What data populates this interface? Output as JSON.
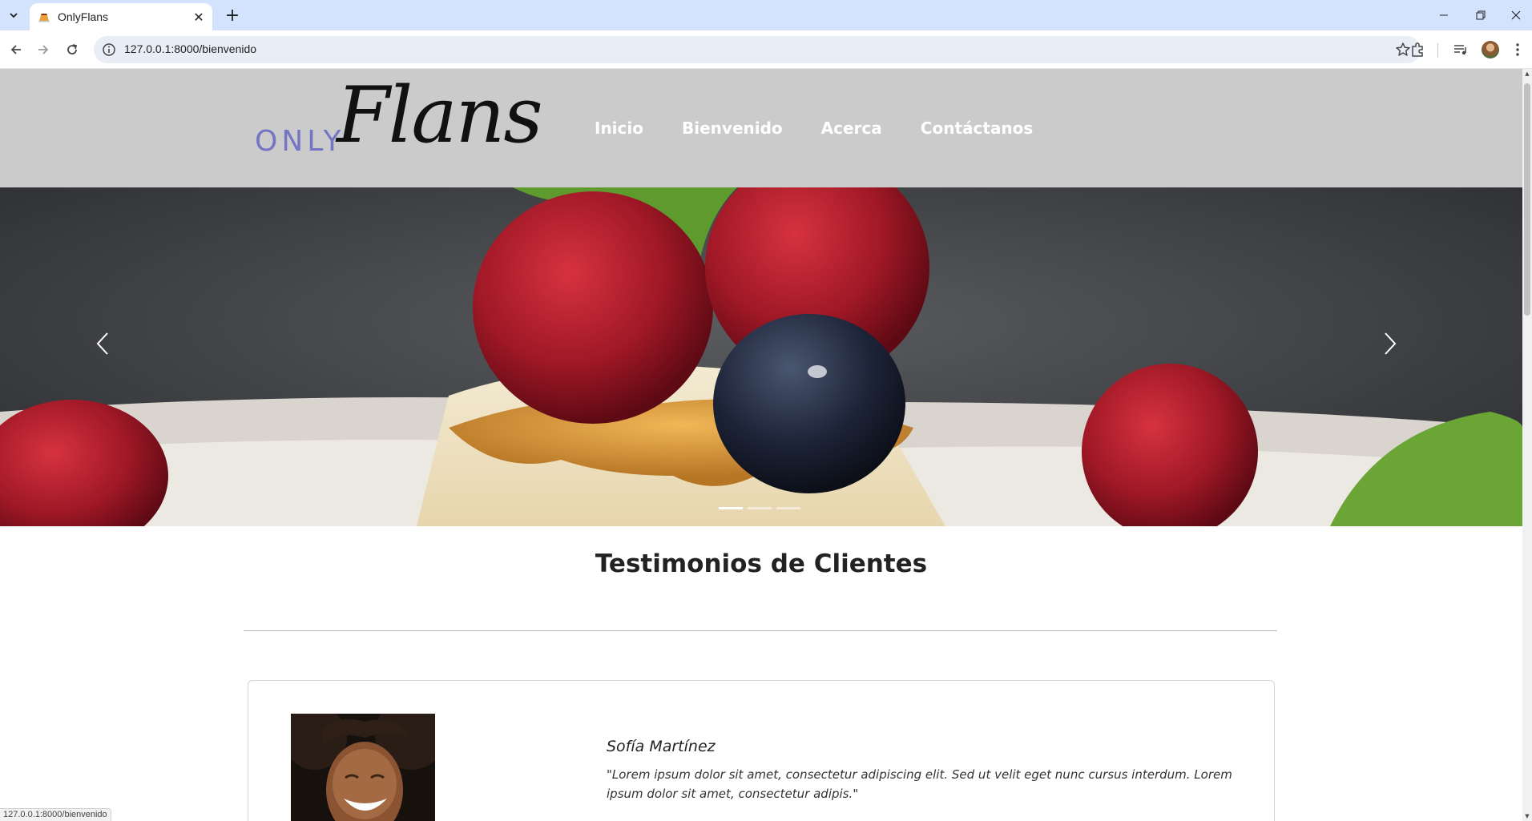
{
  "browser": {
    "tab_title": "OnlyFlans",
    "url": "127.0.0.1:8000/bienvenido",
    "status_url": "127.0.0.1:8000/bienvenido"
  },
  "site": {
    "logo_prefix": "ONLY",
    "logo_main": "Flans",
    "nav": [
      {
        "label": "Inicio"
      },
      {
        "label": "Bienvenido"
      },
      {
        "label": "Acerca"
      },
      {
        "label": "Contáctanos"
      }
    ]
  },
  "carousel": {
    "slide_count": 3,
    "active_index": 0
  },
  "testimonials": {
    "title": "Testimonios de Clientes",
    "items": [
      {
        "name": "Sofía Martínez",
        "text": "\"Lorem ipsum dolor sit amet, consectetur adipiscing elit. Sed ut velit eget nunc cursus interdum. Lorem ipsum dolor sit amet, consectetur adipis.\""
      }
    ]
  },
  "colors": {
    "header_bg": "#cbcbcb",
    "logo_accent": "#7575c5",
    "tabstrip_bg": "#d3e3fd"
  }
}
